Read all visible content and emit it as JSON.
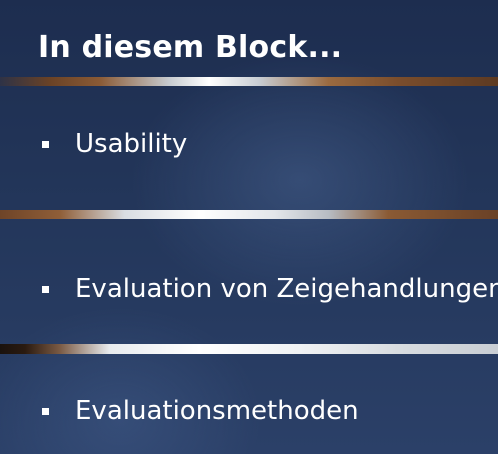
{
  "slide": {
    "title": "In diesem Block...",
    "bullets": [
      {
        "label": "Usability"
      },
      {
        "label": "Evaluation von Zeigehandlungen"
      },
      {
        "label": "Evaluationsmethoden"
      }
    ]
  },
  "colors": {
    "background": "#23365a",
    "text": "#ffffff",
    "rule_accent_copper": "#8a5a35",
    "rule_accent_silver": "#ffffff"
  }
}
